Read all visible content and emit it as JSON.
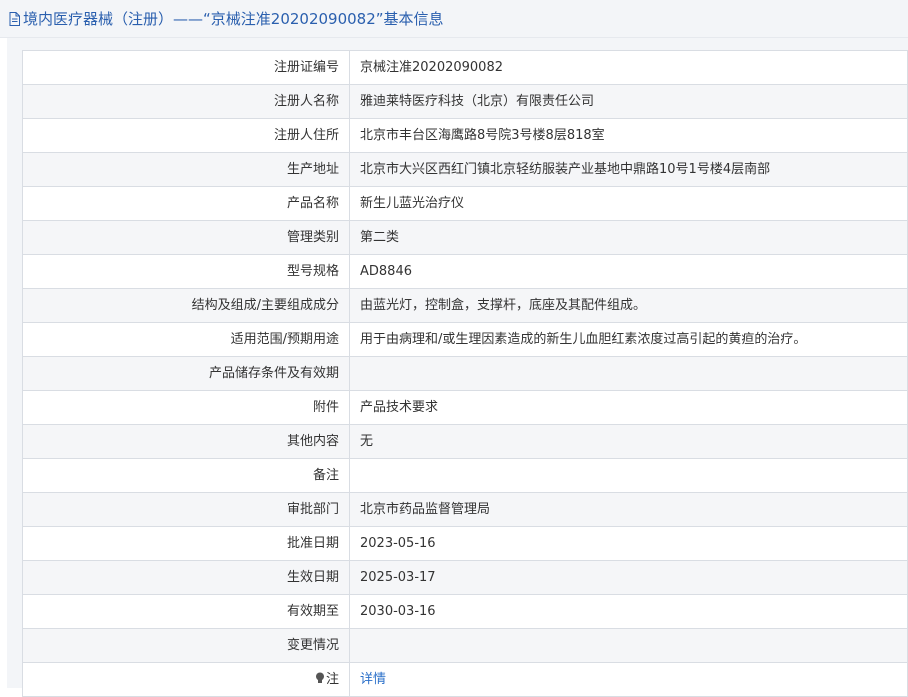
{
  "header": {
    "title": "境内医疗器械（注册）——“京械注准20202090082”基本信息"
  },
  "rows": [
    {
      "label": "注册证编号",
      "value": "京械注准20202090082"
    },
    {
      "label": "注册人名称",
      "value": "雅迪莱特医疗科技（北京）有限责任公司"
    },
    {
      "label": "注册人住所",
      "value": "北京市丰台区海鹰路8号院3号楼8层818室"
    },
    {
      "label": "生产地址",
      "value": "北京市大兴区西红门镇北京轻纺服装产业基地中鼎路10号1号楼4层南部"
    },
    {
      "label": "产品名称",
      "value": "新生儿蓝光治疗仪"
    },
    {
      "label": "管理类别",
      "value": "第二类"
    },
    {
      "label": "型号规格",
      "value": "AD8846"
    },
    {
      "label": "结构及组成/主要组成成分",
      "value": "由蓝光灯，控制盒，支撑杆，底座及其配件组成。"
    },
    {
      "label": "适用范围/预期用途",
      "value": "用于由病理和/或生理因素造成的新生儿血胆红素浓度过高引起的黄疸的治疗。"
    },
    {
      "label": "产品储存条件及有效期",
      "value": ""
    },
    {
      "label": "附件",
      "value": "产品技术要求"
    },
    {
      "label": "其他内容",
      "value": "无"
    },
    {
      "label": "备注",
      "value": ""
    },
    {
      "label": "审批部门",
      "value": "北京市药品监督管理局"
    },
    {
      "label": "批准日期",
      "value": "2023-05-16"
    },
    {
      "label": "生效日期",
      "value": "2025-03-17"
    },
    {
      "label": "有效期至",
      "value": "2030-03-16"
    },
    {
      "label": "变更情况",
      "value": ""
    }
  ],
  "note_row": {
    "label": "注",
    "link_text": "详情",
    "icon": "lightbulb-icon"
  },
  "colors": {
    "title": "#2a5fae",
    "link": "#2a6fc9",
    "border": "#d9dde3",
    "row_alt": "#f5f6f8",
    "panel_bg": "#f3f5f8"
  }
}
